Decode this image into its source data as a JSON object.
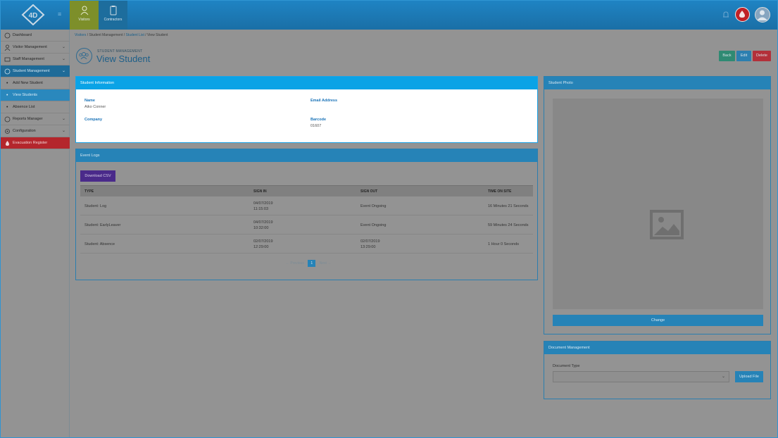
{
  "topbar": {
    "logo_text": "4D",
    "tabs": [
      {
        "label": "Visitors"
      },
      {
        "label": "Contractors"
      }
    ]
  },
  "sidebar": {
    "items": [
      {
        "label": "Dashboard"
      },
      {
        "label": "Visitor Management"
      },
      {
        "label": "Staff Management"
      },
      {
        "label": "Student Management"
      },
      {
        "label": "Add New Student"
      },
      {
        "label": "View Students"
      },
      {
        "label": "Absence List"
      },
      {
        "label": "Reports Manager"
      },
      {
        "label": "Configuration"
      },
      {
        "label": "Evacuation Register"
      }
    ]
  },
  "breadcrumb": {
    "items": [
      "Visitors",
      "Student Management",
      "Student List",
      "View Student"
    ],
    "separator": "/"
  },
  "page": {
    "subtitle": "STUDENT MANAGEMENT",
    "title": "View Student",
    "actions": {
      "back": "Back",
      "edit": "Edit",
      "delete": "Delete"
    }
  },
  "student_info": {
    "heading": "Student Information",
    "name_label": "Name",
    "name_value": "Aiko Conner",
    "email_label": "Email Address",
    "email_value": "",
    "company_label": "Company",
    "company_value": "",
    "barcode_label": "Barcode",
    "barcode_value": "01607"
  },
  "event_logs": {
    "heading": "Event Logs",
    "download_label": "Download CSV",
    "columns": [
      "TYPE",
      "SIGN IN",
      "SIGN OUT",
      "TIME ON SITE"
    ],
    "rows": [
      {
        "type": "Student: Log",
        "sign_in_date": "04/07/2019",
        "sign_in_time": "11:15:03",
        "sign_out_date": "Event Ongoing",
        "sign_out_time": "",
        "time_on_site": "16 Minutes 21 Seconds"
      },
      {
        "type": "Student: EarlyLeaver",
        "sign_in_date": "04/07/2019",
        "sign_in_time": "10:32:00",
        "sign_out_date": "Event Ongoing",
        "sign_out_time": "",
        "time_on_site": "59 Minutes 24 Seconds"
      },
      {
        "type": "Student: Absence",
        "sign_in_date": "02/07/2019",
        "sign_in_time": "12:29:00",
        "sign_out_date": "02/07/2019",
        "sign_out_time": "13:29:00",
        "time_on_site": "1 Hour 0 Seconds"
      }
    ],
    "pager": {
      "previous": "← Previous",
      "current": "1",
      "next": "Next →"
    }
  },
  "student_photo": {
    "heading": "Student Photo",
    "change_label": "Change"
  },
  "documents": {
    "heading": "Document Management",
    "type_label": "Document Type",
    "type_value": "",
    "upload_label": "Upload File"
  }
}
